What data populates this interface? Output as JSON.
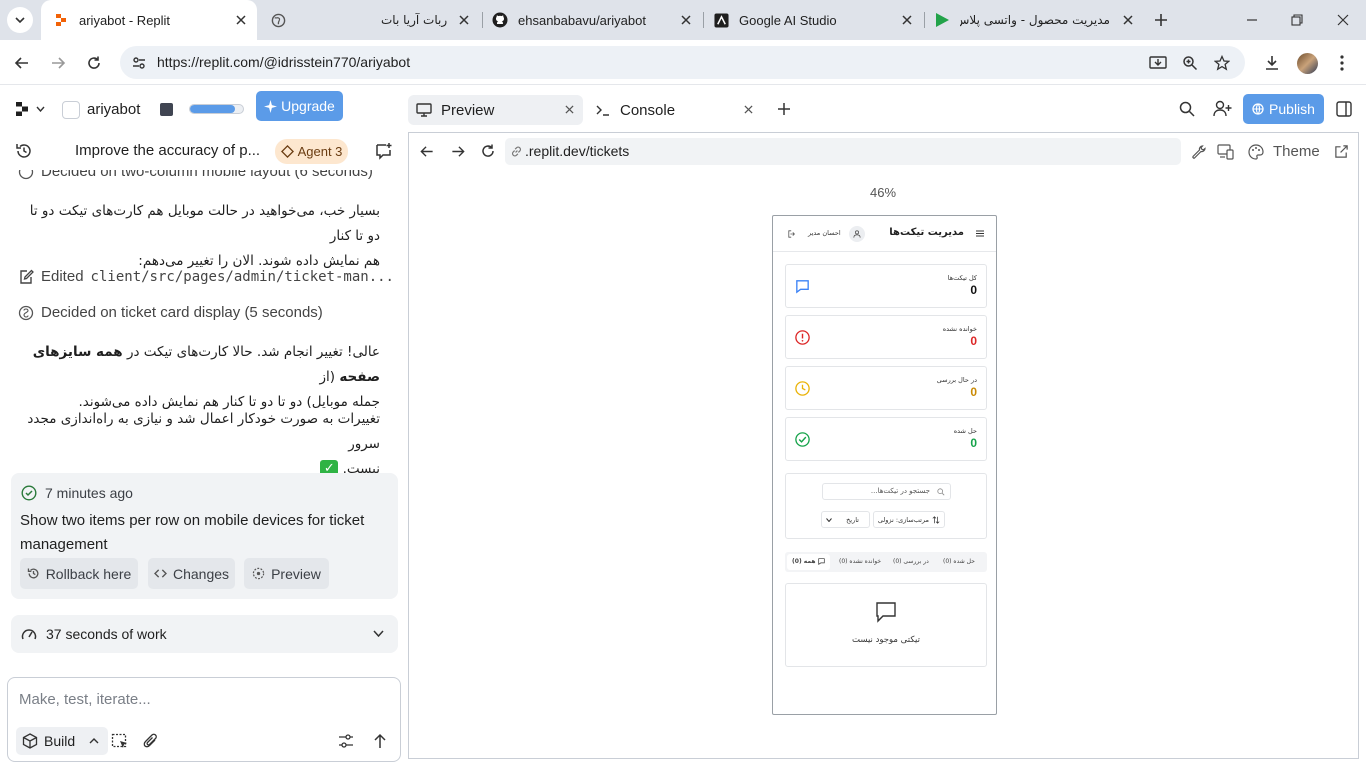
{
  "browser": {
    "tabs": [
      {
        "title": "ariyabot - Replit",
        "icon": "replit-icon"
      },
      {
        "title": "ربات آریا بات",
        "icon": "globe-icon"
      },
      {
        "title": "ehsanbabavu/ariyabot",
        "icon": "github-icon"
      },
      {
        "title": "Google AI Studio",
        "icon": "ai-studio-icon"
      },
      {
        "title": "مدیریت محصول - واتسی پلاس",
        "icon": "play-icon"
      }
    ],
    "url": "https://replit.com/@idrisstein770/ariyabot"
  },
  "replit": {
    "project_name": "ariyabot",
    "upgrade_label": "Upgrade",
    "progress_fraction": 0.85,
    "task_title": "Improve the accuracy of p...",
    "agent_label": "Agent 3",
    "chat": {
      "decided_two_col": "Decided on two-column mobile layout (6 seconds)",
      "msg1_line1": "بسیار خب، می‌خواهید در حالت موبایل هم کارت‌های تیکت دو تا دو تا کنار",
      "msg1_line2": "هم نمایش داده شوند. الان را تغییر می‌دهم:",
      "edited_prefix": "Edited",
      "edited_file": "client/src/pages/admin/ticket-man...",
      "decided_card": "Decided on ticket card display (5 seconds)",
      "msg2_part1": "عالی! تغییر انجام شد. حالا کارت‌های تیکت در",
      "msg2_bold": "همه سایزهای صفحه",
      "msg2_part2": "(از",
      "msg2_line2": "جمله موبایل) دو تا دو تا کنار هم نمایش داده می‌شوند.",
      "msg3_line1": "تغییرات به صورت خودکار اعمال شد و نیازی به راه‌اندازی مجدد سرور",
      "msg3_line2": "نیست.",
      "check_emoji": "✓"
    },
    "checkpoint": {
      "time": "7 minutes ago",
      "message": "Show two items per row on mobile devices for ticket management",
      "rollback_label": "Rollback here",
      "changes_label": "Changes",
      "preview_label": "Preview"
    },
    "work_label": "37 seconds of work",
    "input_placeholder": "Make, test, iterate...",
    "build_label": "Build",
    "tabs": {
      "preview": "Preview",
      "console": "Console"
    },
    "publish_label": "Publish",
    "preview_url": ".replit.dev/tickets",
    "theme_label": "Theme",
    "zoom": "46%"
  },
  "app": {
    "title": "مدیریت تیکت‌ها",
    "user": "احسان مدیر",
    "stats": [
      {
        "label": "کل تیکت‌ها",
        "value": "0",
        "color": "#111111",
        "icon": "chat-icon",
        "icon_color": "#3b82f6"
      },
      {
        "label": "خوانده نشده",
        "value": "0",
        "color": "#dc2626",
        "icon": "alert-icon",
        "icon_color": "#dc2626"
      },
      {
        "label": "در حال بررسی",
        "value": "0",
        "color": "#ca8a04",
        "icon": "clock-icon",
        "icon_color": "#eab308"
      },
      {
        "label": "حل شده",
        "value": "0",
        "color": "#16a34a",
        "icon": "check-circle-icon",
        "icon_color": "#16a34a"
      }
    ],
    "search_placeholder": "جستجو در تیکت‌ها...",
    "sort_label": "مرتب‌سازی: نزولی",
    "date_label": "تاریخ",
    "filters": {
      "all": "همه (0)",
      "unread": "خوانده نشده (0)",
      "review": "در بررسی (0)",
      "solved": "حل شده (0)"
    },
    "empty_message": "تیکتی موجود نیست"
  }
}
